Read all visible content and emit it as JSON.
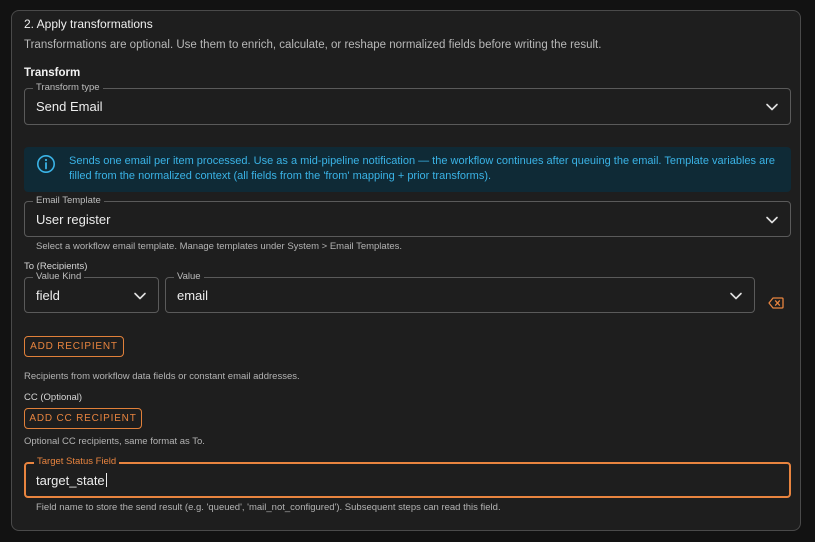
{
  "section": {
    "title": "2. Apply transformations",
    "description": "Transformations are optional. Use them to enrich, calculate, or reshape normalized fields before writing the result."
  },
  "transform": {
    "label": "Transform",
    "type_legend": "Transform type",
    "type_value": "Send Email"
  },
  "info": {
    "text": "Sends one email per item processed. Use as a mid-pipeline notification — the workflow continues after queuing the email. Template variables are filled from the normalized context (all fields from the 'from' mapping + prior transforms).",
    "color": "#3ab3e6"
  },
  "email_template": {
    "legend": "Email Template",
    "value": "User register",
    "help": "Select a workflow email template. Manage templates under System > Email Templates."
  },
  "recipients": {
    "label": "To (Recipients)",
    "value_kind_legend": "Value Kind",
    "value_kind": "field",
    "value_legend": "Value",
    "value": "email",
    "add_button": "ADD RECIPIENT",
    "help": "Recipients from workflow data fields or constant email addresses."
  },
  "cc": {
    "label": "CC (Optional)",
    "add_button": "ADD CC RECIPIENT",
    "help": "Optional CC recipients, same format as To."
  },
  "target_status": {
    "legend": "Target Status Field",
    "value": "target_state",
    "help": "Field name to store the send result (e.g. 'queued', 'mail_not_configured'). Subsequent steps can read this field."
  },
  "colors": {
    "accent": "#e8843f",
    "info_bg": "#0f2a36"
  }
}
